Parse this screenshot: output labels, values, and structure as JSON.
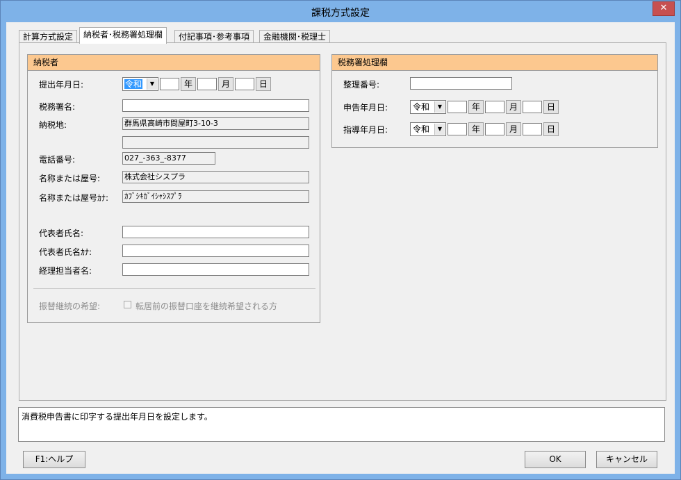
{
  "window": {
    "title": "課税方式設定",
    "close_glyph": "✕"
  },
  "tabs": [
    {
      "label": "計算方式設定"
    },
    {
      "label": "納税者･税務署処理欄"
    },
    {
      "label": "付記事項･参考事項"
    },
    {
      "label": "金融機関･税理士"
    }
  ],
  "taxpayer": {
    "header": "納税者",
    "submit_date_label": "提出年月日:",
    "submit_era": "令和",
    "year_unit": "年",
    "month_unit": "月",
    "day_unit": "日",
    "tax_office_label": "税務署名:",
    "tax_office_value": "",
    "address_label": "納税地:",
    "address_line1": "群馬県高崎市問屋町3-10-3",
    "address_line2": "",
    "phone_label": "電話番号:",
    "phone_value": "027_-363_-8377",
    "name_label": "名称または屋号:",
    "name_value": "株式会社シスプラ",
    "name_kana_label": "名称または屋号ｶﾅ:",
    "name_kana_value": "ｶﾌﾞｼｷｶﾞｲｼｬｼｽﾌﾟﾗ",
    "rep_name_label": "代表者氏名:",
    "rep_name_value": "",
    "rep_kana_label": "代表者氏名ｶﾅ:",
    "rep_kana_value": "",
    "accountant_label": "経理担当者名:",
    "accountant_value": "",
    "transfer_label": "振替継続の希望:",
    "transfer_checkbox_label": "転居前の振替口座を継続希望される方"
  },
  "office": {
    "header": "税務署処理欄",
    "ref_no_label": "整理番号:",
    "ref_no_value": "",
    "report_date_label": "申告年月日:",
    "report_era": "令和",
    "guidance_date_label": "指導年月日:",
    "guidance_era": "令和"
  },
  "status": {
    "message": "消費税申告書に印字する提出年月日を設定します。"
  },
  "buttons": {
    "help": "F1:ヘルプ",
    "ok": "OK",
    "cancel": "キャンセル"
  },
  "colors": {
    "group_header": "#fcc88f",
    "titlebar": "#7eb2e8",
    "close": "#c75050",
    "selection": "#3399ff"
  }
}
